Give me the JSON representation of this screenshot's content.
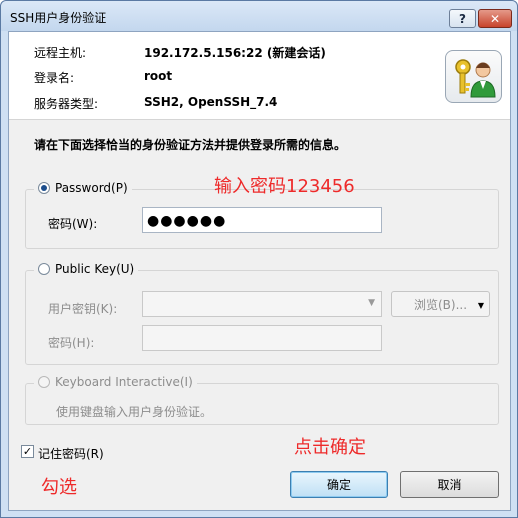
{
  "window": {
    "title": "SSH用户身份验证",
    "help_label": "?",
    "close_label": "✕"
  },
  "info": {
    "rows": [
      {
        "label": "远程主机:",
        "value": "192.172.5.156:22 (新建会话)"
      },
      {
        "label": "登录名:",
        "value": "root"
      },
      {
        "label": "服务器类型:",
        "value": "SSH2, OpenSSH_7.4"
      }
    ],
    "logo_icon": "key-user-icon"
  },
  "instruction": "请在下面选择恰当的身份验证方法并提供登录所需的信息。",
  "password_group": {
    "radio_label": "Password(P)",
    "selected": true,
    "field_label": "密码(W):",
    "field_value": "●●●●●●"
  },
  "publickey_group": {
    "radio_label": "Public Key(U)",
    "selected": false,
    "user_key_label": "用户密钥(K):",
    "browse_label": "浏览(B)...",
    "passphrase_label": "密码(H):"
  },
  "keyboard_group": {
    "radio_label": "Keyboard Interactive(I)",
    "description": "使用键盘输入用户身份验证。"
  },
  "remember": {
    "label": "记住密码(R)",
    "checked": true
  },
  "buttons": {
    "ok": "确定",
    "cancel": "取消"
  },
  "annotations": {
    "enter_password": "输入密码123456",
    "click_ok": "点击确定",
    "check": "勾选"
  },
  "colors": {
    "annotation": "#ee2a2a",
    "window_frame": "#cfe0f3"
  }
}
